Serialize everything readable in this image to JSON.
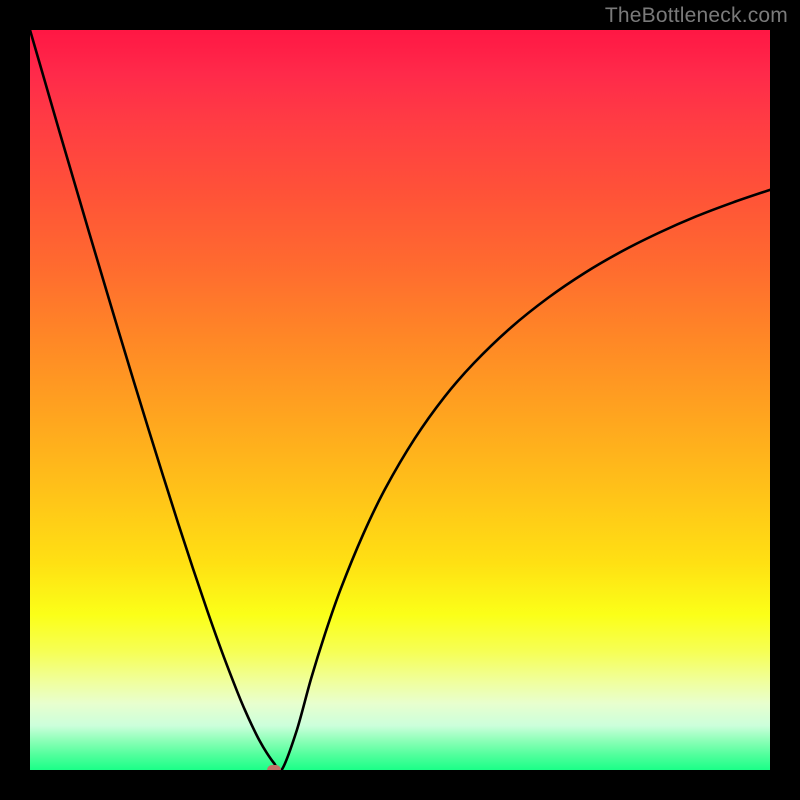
{
  "watermark": "TheBottleneck.com",
  "chart_data": {
    "type": "line",
    "title": "",
    "xlabel": "",
    "ylabel": "",
    "xlim": [
      0,
      100
    ],
    "ylim": [
      0,
      100
    ],
    "grid": false,
    "legend": false,
    "marker": {
      "x": 33,
      "y": 0,
      "color": "#c17368"
    },
    "background_gradient": {
      "direction": "vertical",
      "stops": [
        {
          "pos": 0,
          "color": "#ff1744"
        },
        {
          "pos": 50,
          "color": "#ffa41f"
        },
        {
          "pos": 80,
          "color": "#fbff18"
        },
        {
          "pos": 100,
          "color": "#1bff88"
        }
      ]
    },
    "series": [
      {
        "name": "bottleneck-curve",
        "x": [
          0,
          2,
          4,
          6,
          8,
          10,
          12,
          14,
          16,
          18,
          20,
          22,
          24,
          26,
          28,
          29,
          30,
          31,
          32,
          33,
          34,
          36,
          38,
          40,
          42,
          45,
          48,
          52,
          56,
          60,
          65,
          70,
          75,
          80,
          85,
          90,
          95,
          100
        ],
        "y": [
          100,
          93.1,
          86.2,
          79.4,
          72.6,
          65.9,
          59.2,
          52.6,
          46.1,
          39.7,
          33.4,
          27.3,
          21.4,
          15.8,
          10.6,
          8.2,
          6.0,
          4.0,
          2.3,
          0.9,
          0.0,
          5.2,
          12.4,
          18.8,
          24.5,
          31.8,
          38.0,
          44.8,
          50.4,
          55.0,
          59.8,
          63.8,
          67.2,
          70.1,
          72.6,
          74.8,
          76.7,
          78.4
        ]
      }
    ]
  }
}
